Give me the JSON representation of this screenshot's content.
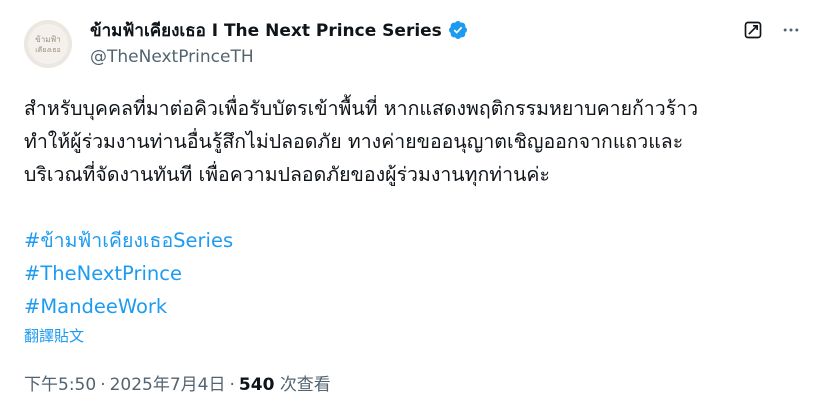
{
  "account": {
    "display_name": "ข้ามฟ้าเคียงเธอ I The Next Prince Series",
    "handle": "@TheNextPrinceTH",
    "verified": true,
    "avatar_text": "ข้ามฟ้าเคียงเธอ",
    "verified_color": "#1d9bf0"
  },
  "icons": {
    "grok": "grok-icon",
    "more": "more-icon"
  },
  "tweet": {
    "lines": [
      "สำหรับบุคคลที่มาต่อคิวเพื่อรับบัตรเข้าพื้นที่ หากแสดงพฤติกรรมหยาบคายก้าวร้าว",
      "ทำให้ผู้ร่วมงานท่านอื่นรู้สึกไม่ปลอดภัย ทางค่ายขออนุญาตเชิญออกจากแถวและ",
      "บริเวณที่จัดงานทันที เพื่อความปลอดภัยของผู้ร่วมงานทุกท่านค่ะ"
    ],
    "hashtags": [
      "#ข้ามฟ้าเคียงเธอSeries",
      "#TheNextPrince",
      "#MandeeWork"
    ],
    "translate_label": "翻譯貼文"
  },
  "meta": {
    "time": "下午5:50",
    "separator": "·",
    "date": "2025年7月4日",
    "views_count": "540",
    "views_label": "次查看"
  },
  "colors": {
    "text": "#0f1419",
    "secondary": "#536471",
    "link": "#1d9bf0"
  }
}
